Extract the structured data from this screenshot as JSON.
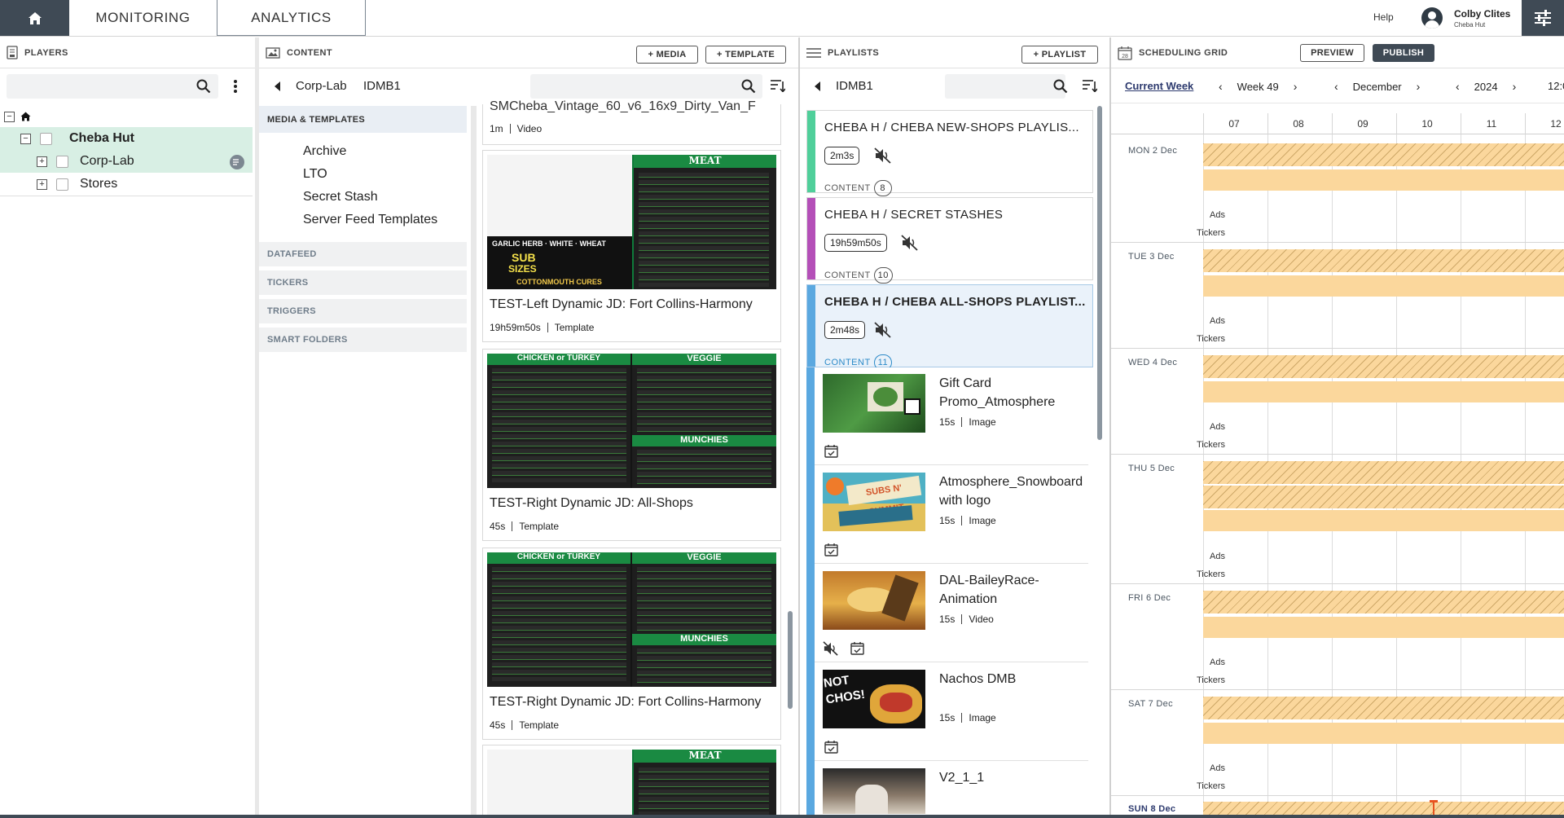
{
  "topbar": {
    "tabs": [
      "MONITORING",
      "ANALYTICS"
    ],
    "help": "Help",
    "user_name": "Colby Clites",
    "user_org": "Cheba Hut"
  },
  "players": {
    "title": "PLAYERS",
    "search_placeholder": "",
    "tree": [
      {
        "label": "Cheba Hut",
        "level": 1,
        "selected": true
      },
      {
        "label": "Corp-Lab",
        "level": 2,
        "selected": true
      },
      {
        "label": "Stores",
        "level": 2,
        "selected": false
      }
    ]
  },
  "content": {
    "title": "CONTENT",
    "add_media": "+ MEDIA",
    "add_template": "+ TEMPLATE",
    "breadcrumb": [
      "Corp-Lab",
      "IDMB1"
    ],
    "section_selected": "MEDIA & TEMPLATES",
    "folders": [
      "Archive",
      "LTO",
      "Secret Stash",
      "Server Feed Templates"
    ],
    "categories": [
      "DATAFEED",
      "TICKERS",
      "TRIGGERS",
      "SMART FOLDERS"
    ],
    "partial_card": {
      "title": "SMCheba_Vintage_60_v6_16x9_Dirty_Van_F",
      "duration": "1m",
      "type": "Video"
    },
    "cards": [
      {
        "title": "TEST-Left Dynamic JD: Fort Collins-Harmony",
        "duration": "19h59m50s",
        "type": "Template"
      },
      {
        "title": "TEST-Right Dynamic JD: All-Shops",
        "duration": "45s",
        "type": "Template"
      },
      {
        "title": "TEST-Right Dynamic JD: Fort Collins-Harmony",
        "duration": "45s",
        "type": "Template"
      }
    ],
    "thumb_text": {
      "meat": "MEAT",
      "veggie": "VEGGIE",
      "chicken": "CHICKEN or TURKEY",
      "munchies": "MUNCHIES",
      "garlic": "GARLIC HERB · WHITE · WHEAT",
      "sub": "SUB",
      "sizes": "SIZES",
      "cottonmouth": "COTTONMOUTH CURES"
    }
  },
  "playlists": {
    "title": "PLAYLISTS",
    "add_playlist": "+ PLAYLIST",
    "breadcrumb": "IDMB1",
    "cards": [
      {
        "title": "CHEBA H /  CHEBA NEW-SHOPS PLAYLIS...",
        "duration": "2m3s",
        "content_label": "CONTENT",
        "count": "8",
        "color": "#4fcf9a"
      },
      {
        "title": "CHEBA H /  SECRET STASHES",
        "duration": "19h59m50s",
        "content_label": "CONTENT",
        "count": "10",
        "color": "#b44fb8"
      },
      {
        "title": "CHEBA H /  CHEBA ALL-SHOPS PLAYLIST...",
        "duration": "2m48s",
        "content_label": "CONTENT",
        "count": "11",
        "color": "#5aa8e0"
      }
    ],
    "items": [
      {
        "name": "Gift Card Promo_Atmosphere",
        "duration": "15s",
        "type": "Image",
        "muted": false
      },
      {
        "name": "Atmosphere_Snowboard with logo",
        "duration": "15s",
        "type": "Image",
        "muted": false
      },
      {
        "name": "DAL-BaileyRace-Animation",
        "duration": "15s",
        "type": "Video",
        "muted": true
      },
      {
        "name": "Nachos DMB",
        "duration": "15s",
        "type": "Image",
        "muted": false
      },
      {
        "name": "V2_1_1",
        "duration": "",
        "type": "",
        "muted": false
      }
    ],
    "thumb_text": {
      "nachos": "NOT CHOS!",
      "subs": "SUBS N' SUMMIT"
    }
  },
  "scheduling": {
    "title": "SCHEDULING GRID",
    "preview": "PREVIEW",
    "publish": "PUBLISH",
    "current_week": "Current Week",
    "week": "Week 49",
    "month": "December",
    "year": "2024",
    "hours": [
      "07",
      "08",
      "09",
      "10",
      "11",
      "12"
    ],
    "partial_hour": "12:0",
    "row_labels": [
      "Ads",
      "Tickers"
    ],
    "days": [
      "MON 2 Dec",
      "TUE 3 Dec",
      "WED 4 Dec",
      "THU 5 Dec",
      "FRI 6 Dec",
      "SAT 7 Dec",
      "SUN 8 Dec"
    ]
  }
}
